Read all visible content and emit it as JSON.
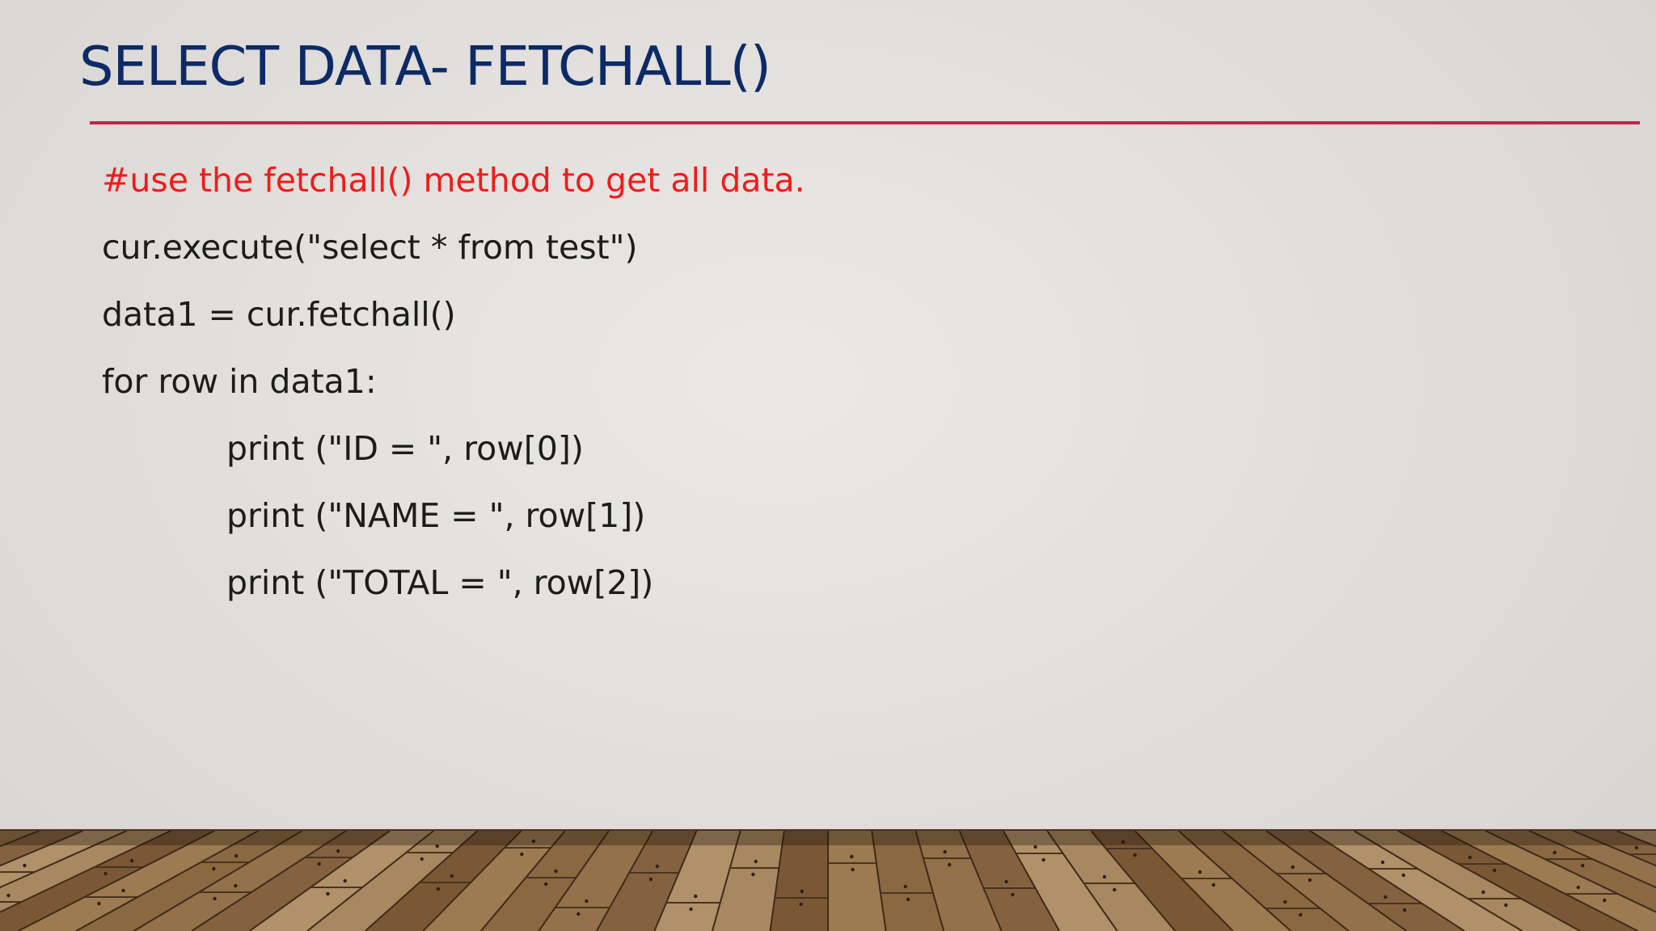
{
  "slide": {
    "title": "SELECT DATA- FETCHALL()",
    "lines": [
      {
        "text": "#use the fetchall() method to get all data.",
        "kind": "comment",
        "indent": 0
      },
      {
        "text": "cur.execute(\"select * from test\")",
        "kind": "code",
        "indent": 0
      },
      {
        "text": "data1 = cur.fetchall()",
        "kind": "code",
        "indent": 0
      },
      {
        "text": "for row in data1:",
        "kind": "code",
        "indent": 0
      },
      {
        "text": "print (\"ID = \", row[0])",
        "kind": "code",
        "indent": 1
      },
      {
        "text": "print (\"NAME = \", row[1])",
        "kind": "code",
        "indent": 1
      },
      {
        "text": "print (\"TOTAL = \", row[2])",
        "kind": "code",
        "indent": 1
      }
    ]
  },
  "colors": {
    "title": "#0e2a66",
    "accent_rule": "#c0264a",
    "comment": "#ee1c1c",
    "body_text": "#1c1c1c"
  },
  "decor": {
    "floor": "wooden-floor-planks"
  }
}
